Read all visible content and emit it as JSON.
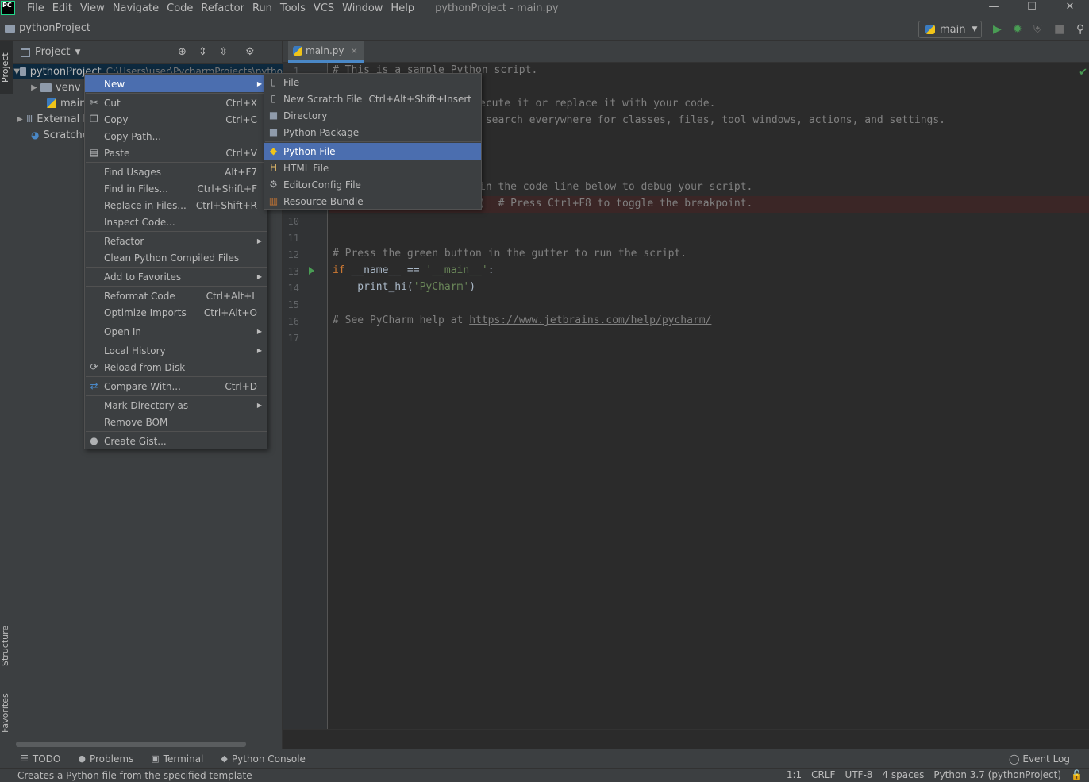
{
  "menubar": {
    "logo": "PC",
    "items": [
      "File",
      "Edit",
      "View",
      "Navigate",
      "Code",
      "Refactor",
      "Run",
      "Tools",
      "VCS",
      "Window",
      "Help"
    ],
    "window_title": "pythonProject - main.py",
    "controls": [
      "—",
      "☐",
      "✕"
    ]
  },
  "navbar": {
    "project": "pythonProject",
    "run_config": "main"
  },
  "side_tabs": {
    "project": "Project",
    "structure": "Structure",
    "favorites": "Favorites"
  },
  "project_panel": {
    "title": "Project",
    "tree": [
      {
        "label": "pythonProject",
        "hint": "C:\\Users\\user\\PycharmProjects\\pytho"
      },
      {
        "label": "venv"
      },
      {
        "label": "main."
      },
      {
        "label": "External L"
      },
      {
        "label": "Scratches"
      }
    ]
  },
  "editor": {
    "tab": "main.py",
    "line_numbers": [
      "1",
      "10",
      "11",
      "12",
      "13",
      "14",
      "15",
      "16",
      "17"
    ],
    "lines": {
      "l1": "# This is a sample Python script.",
      "l3": "ecute it or replace it with your code.",
      "l4": " search everywhere for classes, files, tool windows, actions, and settings.",
      "l8": "in the code line below to debug your script.",
      "l9": ")  # Press Ctrl+F8 to toggle the breakpoint.",
      "l12": "# Press the green button in the gutter to run the script.",
      "l13_kw": "if",
      "l13_mid": " __name__ == ",
      "l13_str": "'__main__'",
      "l13_end": ":",
      "l14_a": "    print_hi(",
      "l14_str": "'PyCharm'",
      "l14_b": ")",
      "l16_a": "# See PyCharm help at ",
      "l16_link": "https://www.jetbrains.com/help/pycharm/"
    }
  },
  "context_menu": {
    "items": [
      {
        "label": "New",
        "shortcut": ""
      },
      {
        "label": "Cut",
        "shortcut": "Ctrl+X"
      },
      {
        "label": "Copy",
        "shortcut": "Ctrl+C"
      },
      {
        "label": "Copy Path...",
        "shortcut": ""
      },
      {
        "label": "Paste",
        "shortcut": "Ctrl+V"
      },
      {
        "label": "Find Usages",
        "shortcut": "Alt+F7"
      },
      {
        "label": "Find in Files...",
        "shortcut": "Ctrl+Shift+F"
      },
      {
        "label": "Replace in Files...",
        "shortcut": "Ctrl+Shift+R"
      },
      {
        "label": "Inspect Code...",
        "shortcut": ""
      },
      {
        "label": "Refactor",
        "shortcut": ""
      },
      {
        "label": "Clean Python Compiled Files",
        "shortcut": ""
      },
      {
        "label": "Add to Favorites",
        "shortcut": ""
      },
      {
        "label": "Reformat Code",
        "shortcut": "Ctrl+Alt+L"
      },
      {
        "label": "Optimize Imports",
        "shortcut": "Ctrl+Alt+O"
      },
      {
        "label": "Open In",
        "shortcut": ""
      },
      {
        "label": "Local History",
        "shortcut": ""
      },
      {
        "label": "Reload from Disk",
        "shortcut": ""
      },
      {
        "label": "Compare With...",
        "shortcut": "Ctrl+D"
      },
      {
        "label": "Mark Directory as",
        "shortcut": ""
      },
      {
        "label": "Remove BOM",
        "shortcut": ""
      },
      {
        "label": "Create Gist...",
        "shortcut": ""
      }
    ]
  },
  "new_submenu": {
    "items": [
      {
        "label": "File",
        "shortcut": ""
      },
      {
        "label": "New Scratch File",
        "shortcut": "Ctrl+Alt+Shift+Insert"
      },
      {
        "label": "Directory",
        "shortcut": ""
      },
      {
        "label": "Python Package",
        "shortcut": ""
      },
      {
        "label": "Python File",
        "shortcut": ""
      },
      {
        "label": "HTML File",
        "shortcut": ""
      },
      {
        "label": "EditorConfig File",
        "shortcut": ""
      },
      {
        "label": "Resource Bundle",
        "shortcut": ""
      }
    ]
  },
  "bottom_bar": {
    "todo": "TODO",
    "problems": "Problems",
    "terminal": "Terminal",
    "python_console": "Python Console",
    "event_log": "Event Log"
  },
  "status_bar": {
    "message": "Creates a Python file from the specified template",
    "position": "1:1",
    "line_sep": "CRLF",
    "encoding": "UTF-8",
    "indent": "4 spaces",
    "interpreter": "Python 3.7 (pythonProject)"
  },
  "colors": {
    "accent": "#4b6eaf",
    "background": "#2b2b2b",
    "panel": "#3c3f41",
    "run_green": "#499c54"
  }
}
